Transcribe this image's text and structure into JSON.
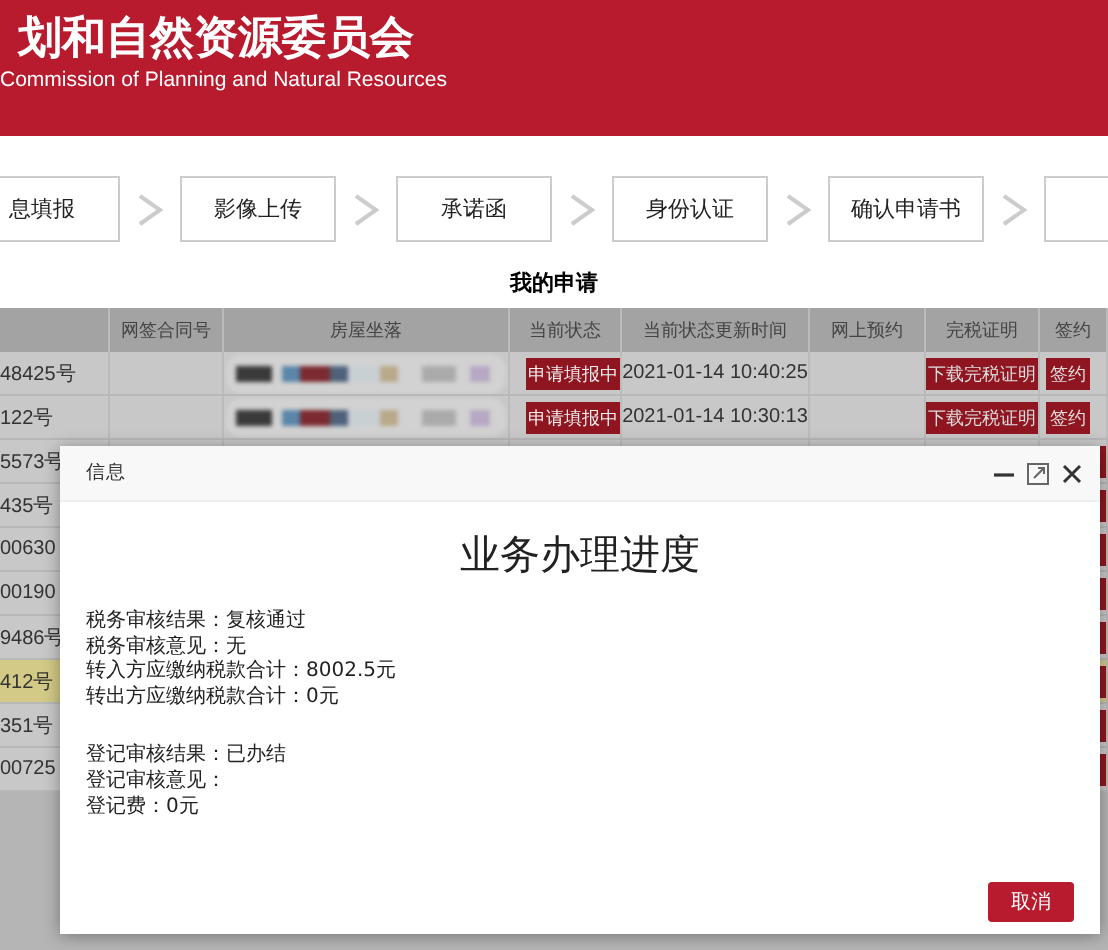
{
  "header": {
    "title": "划和自然资源委员会",
    "subtitle": "Commission of Planning and Natural Resources"
  },
  "steps": [
    {
      "label": "息填报"
    },
    {
      "label": "影像上传"
    },
    {
      "label": "承诺函"
    },
    {
      "label": "身份认证"
    },
    {
      "label": "确认申请书"
    },
    {
      "kind": "cut"
    }
  ],
  "section_title": "我的申请",
  "table": {
    "columns": [
      "",
      "网签合同号",
      "房屋坐落",
      "当前状态",
      "当前状态更新时间",
      "网上预约",
      "完税证明",
      "签约"
    ],
    "rows": [
      {
        "column_1": "48425号",
        "status": "申请填报中",
        "updated": "2021-01-14 10:40:25",
        "tax_button": "下载完税证明",
        "sign": "签约",
        "selected": false
      },
      {
        "column_1": "122号",
        "status": "申请填报中",
        "updated": "2021-01-14 10:30:13",
        "tax_button": "下载完税证明",
        "sign": "签约",
        "selected": false
      },
      {
        "column_1": "5573号",
        "selected": false
      },
      {
        "column_1": "435号",
        "selected": false
      },
      {
        "column_1": "00630",
        "selected": false
      },
      {
        "column_1": "00190",
        "selected": false
      },
      {
        "column_1": "9486号",
        "selected": false
      },
      {
        "column_1": "412号",
        "selected": true
      },
      {
        "column_1": "351号",
        "selected": false
      },
      {
        "column_1": "00725",
        "selected": false
      }
    ]
  },
  "dialog": {
    "title": "信息",
    "heading": "业务办理进度",
    "groups": [
      [
        "税务审核结果：复核通过",
        "税务审核意见：无",
        "转入方应缴纳税款合计：8002.5元",
        "转出方应缴纳税款合计：0元"
      ],
      [
        "登记审核结果：已办结",
        "登记审核意见：",
        "登记费：0元"
      ]
    ],
    "button": "取消"
  }
}
